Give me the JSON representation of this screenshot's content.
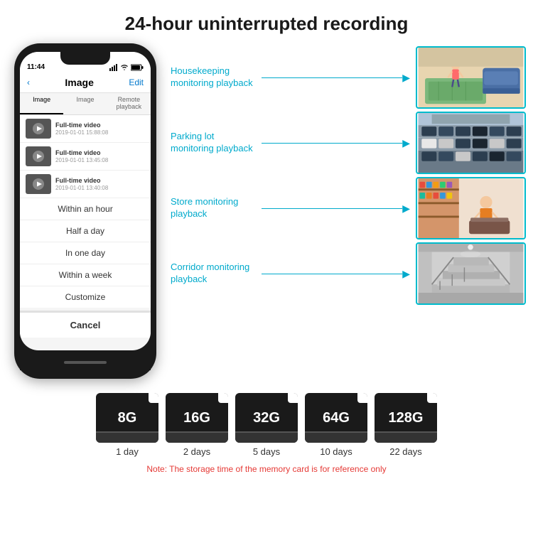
{
  "header": {
    "title": "24-hour uninterrupted recording"
  },
  "phone": {
    "statusBar": {
      "time": "11:44",
      "icons": [
        "signal",
        "wifi",
        "battery"
      ]
    },
    "appHeader": {
      "back": "‹",
      "title": "Image",
      "edit": "Edit"
    },
    "tabs": [
      "Image",
      "Image",
      "Remote playback"
    ],
    "videoItems": [
      {
        "title": "Full-time video",
        "date": "2019-01-01 15:88:08"
      },
      {
        "title": "Full-time video",
        "date": "2019-01-01 13:45:08"
      },
      {
        "title": "Full-time video",
        "date": "2019-01-01 13:40:08"
      }
    ],
    "dropdownItems": [
      "Within an hour",
      "Half a day",
      "In one day",
      "Within a week",
      "Customize"
    ],
    "cancelLabel": "Cancel"
  },
  "monitoring": [
    {
      "label": "Housekeeping\nmonitoring playback",
      "imgType": "housekeeping"
    },
    {
      "label": "Parking lot\nmonitoring playback",
      "imgType": "parking"
    },
    {
      "label": "Store monitoring\nplayback",
      "imgType": "store"
    },
    {
      "label": "Corridor monitoring\nplayback",
      "imgType": "corridor"
    }
  ],
  "storageCards": [
    {
      "size": "8G",
      "days": "1 day"
    },
    {
      "size": "16G",
      "days": "2 days"
    },
    {
      "size": "32G",
      "days": "5 days"
    },
    {
      "size": "64G",
      "days": "10 days"
    },
    {
      "size": "128G",
      "days": "22 days"
    }
  ],
  "storageNote": "Note: The storage time of the memory card is for reference only"
}
